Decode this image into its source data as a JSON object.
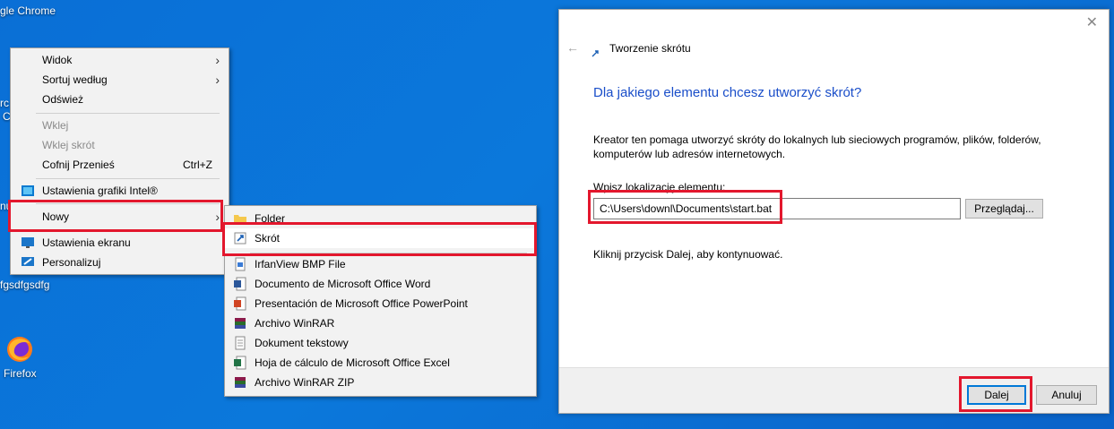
{
  "desktop": {
    "icons": [
      {
        "label": "gle Chrome"
      },
      {
        "label": "fgsdfgsdfg"
      },
      {
        "label": "Firefox"
      }
    ],
    "fragments": [
      "rc",
      "C",
      "nu"
    ]
  },
  "context_menu": {
    "items": [
      {
        "label": "Widok",
        "submenu": true
      },
      {
        "label": "Sortuj według",
        "submenu": true
      },
      {
        "label": "Odśwież"
      },
      {
        "label": "Wklej",
        "disabled": true
      },
      {
        "label": "Wklej skrót",
        "disabled": true
      },
      {
        "label": "Cofnij Przenieś",
        "shortcut": "Ctrl+Z"
      },
      {
        "label": "Ustawienia grafiki Intel®"
      },
      {
        "label": "Nowy",
        "submenu": true
      },
      {
        "label": "Ustawienia ekranu"
      },
      {
        "label": "Personalizuj"
      }
    ]
  },
  "new_submenu": {
    "items": [
      {
        "label": "Folder"
      },
      {
        "label": "Skrót"
      },
      {
        "label": "IrfanView BMP File"
      },
      {
        "label": "Documento de Microsoft Office Word"
      },
      {
        "label": "Presentación de Microsoft Office PowerPoint"
      },
      {
        "label": "Archivo WinRAR"
      },
      {
        "label": "Dokument tekstowy"
      },
      {
        "label": "Hoja de cálculo de Microsoft Office Excel"
      },
      {
        "label": "Archivo WinRAR ZIP"
      }
    ]
  },
  "dialog": {
    "title": "Tworzenie skrótu",
    "heading": "Dla jakiego elementu chcesz utworzyć skrót?",
    "description": "Kreator ten pomaga utworzyć skróty do lokalnych lub sieciowych programów, plików, folderów, komputerów lub adresów internetowych.",
    "location_label": "Wpisz lokalizację elementu:",
    "location_value": "C:\\Users\\downl\\Documents\\start.bat",
    "browse_label": "Przeglądaj...",
    "hint": "Kliknij przycisk Dalej, aby kontynuować.",
    "next_label": "Dalej",
    "cancel_label": "Anuluj"
  },
  "colors": {
    "desktop_bg": "#0a6fd6",
    "heading": "#1a4ec9",
    "highlight_box": "#e3172d",
    "default_button_border": "#0078d7"
  }
}
